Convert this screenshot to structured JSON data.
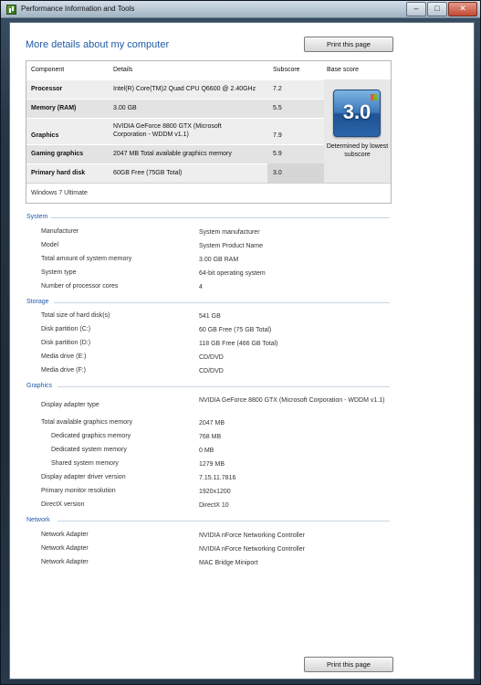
{
  "window": {
    "title": "Performance Information and Tools",
    "buttons": [
      "–",
      "□",
      "✕"
    ]
  },
  "heading": "More details about my computer",
  "print_label": "Print this page",
  "score": {
    "headers": [
      "Component",
      "Details",
      "Subscore",
      "Base score"
    ],
    "rows": [
      {
        "component": "Processor",
        "details": "Intel(R) Core(TM)2 Quad CPU Q6600 @ 2.40GHz",
        "subscore": "7.2"
      },
      {
        "component": "Memory (RAM)",
        "details": "3.00 GB",
        "subscore": "5.5"
      },
      {
        "component": "Graphics",
        "details": "NVIDIA GeForce 8800 GTX (Microsoft Corporation - WDDM v1.1)",
        "subscore": "7.9"
      },
      {
        "component": "Gaming graphics",
        "details": "2047 MB Total available graphics memory",
        "subscore": "5.9"
      },
      {
        "component": "Primary hard disk",
        "details": "60GB Free (75GB Total)",
        "subscore": "3.0"
      }
    ],
    "base_score": "3.0",
    "base_caption": "Determined by lowest subscore",
    "edition": "Windows 7 Ultimate"
  },
  "system": {
    "title": "System",
    "rows": [
      {
        "label": "Manufacturer",
        "value": "System manufacturer"
      },
      {
        "label": "Model",
        "value": "System Product Name"
      },
      {
        "label": "Total amount of system memory",
        "value": "3.00 GB RAM"
      },
      {
        "label": "System type",
        "value": "64-bit operating system"
      },
      {
        "label": "Number of processor cores",
        "value": "4"
      }
    ]
  },
  "storage": {
    "title": "Storage",
    "rows": [
      {
        "label": "Total size of hard disk(s)",
        "value": "541 GB"
      },
      {
        "label": "Disk partition (C:)",
        "value": "60 GB Free (75 GB Total)"
      },
      {
        "label": "Disk partition (D:)",
        "value": "118 GB Free (466 GB Total)"
      },
      {
        "label": "Media drive (E:)",
        "value": "CD/DVD"
      },
      {
        "label": "Media drive (F:)",
        "value": "CD/DVD"
      }
    ]
  },
  "graphics": {
    "title": "Graphics",
    "rows": [
      {
        "label": "Display adapter type",
        "value": "NVIDIA GeForce 8800 GTX (Microsoft Corporation - WDDM v1.1)"
      },
      {
        "label": "Total available graphics memory",
        "value": "2047 MB"
      },
      {
        "label": "Dedicated graphics memory",
        "value": "768 MB"
      },
      {
        "label": "Dedicated system memory",
        "value": "0 MB"
      },
      {
        "label": "Shared system memory",
        "value": "1279 MB"
      },
      {
        "label": "Display adapter driver version",
        "value": "7.15.11.7816"
      },
      {
        "label": "Primary monitor resolution",
        "value": "1920x1200"
      },
      {
        "label": "DirectX version",
        "value": "DirectX 10"
      }
    ]
  },
  "network": {
    "title": "Network",
    "rows": [
      {
        "label": "Network Adapter",
        "value": "NVIDIA nForce Networking Controller"
      },
      {
        "label": "Network Adapter",
        "value": "NVIDIA nForce Networking Controller"
      },
      {
        "label": "Network Adapter",
        "value": "MAC Bridge Miniport"
      }
    ]
  }
}
